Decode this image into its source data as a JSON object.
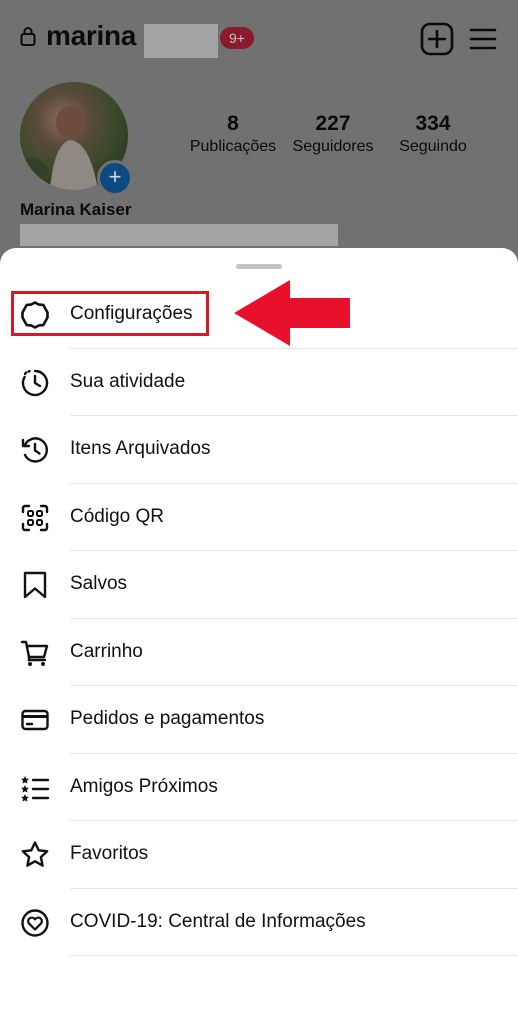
{
  "profile": {
    "username": "marina",
    "notification_badge": "9+",
    "display_name": "Marina Kaiser",
    "stats": [
      {
        "value": "8",
        "label": "Publicações"
      },
      {
        "value": "227",
        "label": "Seguidores"
      },
      {
        "value": "334",
        "label": "Seguindo"
      }
    ]
  },
  "menu": {
    "items": [
      {
        "label": "Configurações",
        "icon": "settings-gear-icon"
      },
      {
        "label": "Sua atividade",
        "icon": "activity-clock-icon"
      },
      {
        "label": "Itens Arquivados",
        "icon": "archive-history-icon"
      },
      {
        "label": "Código QR",
        "icon": "qr-code-icon"
      },
      {
        "label": "Salvos",
        "icon": "bookmark-icon"
      },
      {
        "label": "Carrinho",
        "icon": "cart-icon"
      },
      {
        "label": "Pedidos e pagamentos",
        "icon": "credit-card-icon"
      },
      {
        "label": "Amigos Próximos",
        "icon": "close-friends-list-icon"
      },
      {
        "label": "Favoritos",
        "icon": "star-icon"
      },
      {
        "label": "COVID-19: Central de Informações",
        "icon": "covid-heart-icon"
      }
    ]
  },
  "colors": {
    "highlight": "#d8182a",
    "overlay": "#717171",
    "sheet": "#ffffff"
  }
}
